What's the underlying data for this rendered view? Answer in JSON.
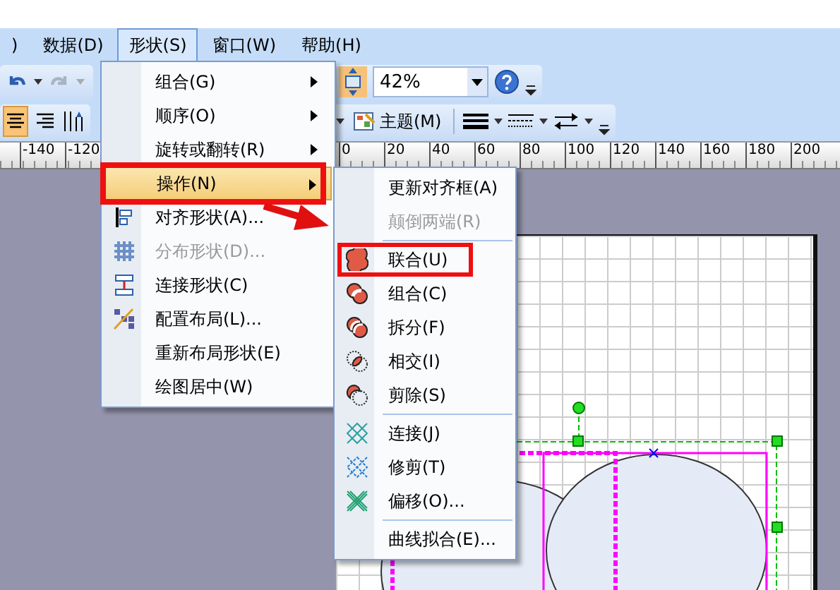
{
  "menubar": [
    {
      "label": ")",
      "selected": false
    },
    {
      "label": "数据(D)",
      "selected": false
    },
    {
      "label": "形状(S)",
      "selected": true
    },
    {
      "label": "窗口(W)",
      "selected": false
    },
    {
      "label": "帮助(H)",
      "selected": false
    }
  ],
  "toolbar": {
    "zoom": "42%",
    "theme_button": "主题(M)",
    "align": [
      {
        "kind": "center",
        "selected": true
      },
      {
        "kind": "right",
        "selected": false
      }
    ]
  },
  "ruler": {
    "left_ticks": [
      "-140",
      "-120"
    ],
    "right_ticks": [
      "0",
      "20",
      "40",
      "60",
      "80",
      "100",
      "120",
      "140",
      "160",
      "180",
      "200"
    ]
  },
  "shape_menu": {
    "items": [
      {
        "label": "组合(G)",
        "kind": "plain",
        "has_submenu": true,
        "disabled": false,
        "selected": false
      },
      {
        "label": "顺序(O)",
        "kind": "plain",
        "has_submenu": true,
        "disabled": false,
        "selected": false
      },
      {
        "label": "旋转或翻转(R)",
        "kind": "plain",
        "has_submenu": true,
        "disabled": false,
        "selected": false
      },
      {
        "label": "操作(N)",
        "kind": "plain",
        "has_submenu": true,
        "disabled": false,
        "selected": true
      },
      {
        "label": "对齐形状(A)...",
        "kind": "align",
        "has_submenu": false,
        "disabled": false,
        "selected": false
      },
      {
        "label": "分布形状(D)...",
        "kind": "distribute",
        "has_submenu": false,
        "disabled": true,
        "selected": false
      },
      {
        "label": "连接形状(C)",
        "kind": "connect",
        "has_submenu": false,
        "disabled": false,
        "selected": false
      },
      {
        "label": "配置布局(L)...",
        "kind": "layout",
        "has_submenu": false,
        "disabled": false,
        "selected": false
      },
      {
        "label": "重新布局形状(E)",
        "kind": "plain",
        "has_submenu": false,
        "disabled": false,
        "selected": false
      },
      {
        "label": "绘图居中(W)",
        "kind": "plain",
        "has_submenu": false,
        "disabled": false,
        "selected": false
      }
    ]
  },
  "operations_menu": {
    "items": [
      {
        "label": "更新对齐框(A)",
        "kind": "plain",
        "separator_before": false,
        "disabled": false,
        "selected": false
      },
      {
        "label": "颠倒两端(R)",
        "kind": "plain",
        "separator_before": false,
        "disabled": true,
        "selected": false
      },
      {
        "label": "联合(U)",
        "kind": "union",
        "separator_before": true,
        "disabled": false,
        "selected": false
      },
      {
        "label": "组合(C)",
        "kind": "combine",
        "separator_before": false,
        "disabled": false,
        "selected": false
      },
      {
        "label": "拆分(F)",
        "kind": "fragment",
        "separator_before": false,
        "disabled": false,
        "selected": false
      },
      {
        "label": "相交(I)",
        "kind": "intersect",
        "separator_before": false,
        "disabled": false,
        "selected": false
      },
      {
        "label": "剪除(S)",
        "kind": "subtract",
        "separator_before": false,
        "disabled": false,
        "selected": false
      },
      {
        "label": "连接(J)",
        "kind": "join",
        "separator_before": true,
        "disabled": false,
        "selected": false
      },
      {
        "label": "修剪(T)",
        "kind": "trim",
        "separator_before": false,
        "disabled": false,
        "selected": false
      },
      {
        "label": "偏移(O)...",
        "kind": "offset",
        "separator_before": false,
        "disabled": false,
        "selected": false
      },
      {
        "label": "曲线拟合(E)...",
        "kind": "plain",
        "separator_before": true,
        "disabled": false,
        "selected": false
      }
    ]
  }
}
